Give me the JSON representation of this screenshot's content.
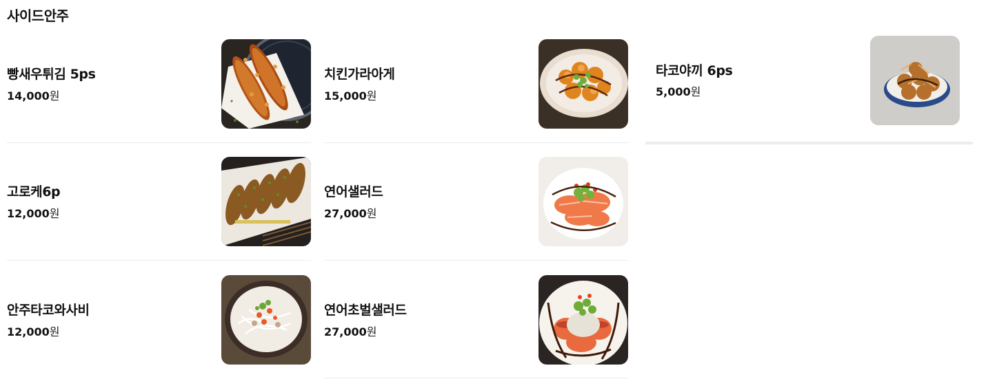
{
  "section": {
    "title": "사이드안주"
  },
  "items": [
    {
      "name": "빵새우튀김 5ps",
      "price": "14,000",
      "currency": "원",
      "image": "fried-shrimp-image"
    },
    {
      "name": "치킨가라아게",
      "price": "15,000",
      "currency": "원",
      "image": "chicken-karaage-image"
    },
    {
      "name": "타코야끼 6ps",
      "price": "5,000",
      "currency": "원",
      "image": "takoyaki-image"
    },
    {
      "name": "고로케6p",
      "price": "12,000",
      "currency": "원",
      "image": "croquette-image"
    },
    {
      "name": "연어샐러드",
      "price": "27,000",
      "currency": "원",
      "image": "salmon-salad-image"
    },
    {
      "name": "안주타코와사비",
      "price": "12,000",
      "currency": "원",
      "image": "tako-wasabi-image"
    },
    {
      "name": "연어초벌샐러드",
      "price": "27,000",
      "currency": "원",
      "image": "seared-salmon-salad-image"
    }
  ]
}
